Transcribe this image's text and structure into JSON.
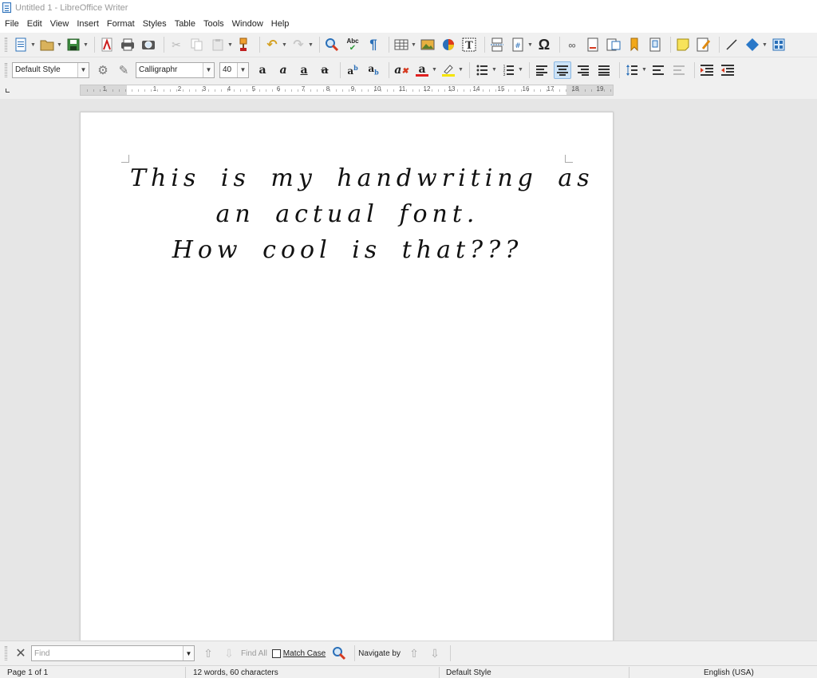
{
  "window": {
    "title": "Untitled 1 - LibreOffice Writer"
  },
  "menu": [
    "File",
    "Edit",
    "View",
    "Insert",
    "Format",
    "Styles",
    "Table",
    "Tools",
    "Window",
    "Help"
  ],
  "formatting": {
    "paragraph_style": "Default Style",
    "font_name": "Calligraphr",
    "font_size": "40"
  },
  "ruler": {
    "numbers": [
      "1",
      "1",
      "2",
      "3",
      "4",
      "5",
      "6",
      "7",
      "8",
      "9",
      "10",
      "11",
      "12",
      "13",
      "14",
      "15",
      "16",
      "17",
      "18",
      "19"
    ]
  },
  "document": {
    "lines": [
      "This is my handwriting as",
      "an actual font.",
      "How cool is that???"
    ]
  },
  "findbar": {
    "placeholder": "Find",
    "find_all": "Find All",
    "match_case": "Match Case",
    "navigate_by": "Navigate by"
  },
  "status": {
    "page": "Page 1 of 1",
    "counts": "12 words, 60 characters",
    "style": "Default Style",
    "language": "English (USA)"
  },
  "colors": {
    "accent": "#2a6fb8",
    "active_button": "#cde3f7",
    "font_color_bar": "#e02020",
    "highlight_bar": "#f5e400"
  }
}
